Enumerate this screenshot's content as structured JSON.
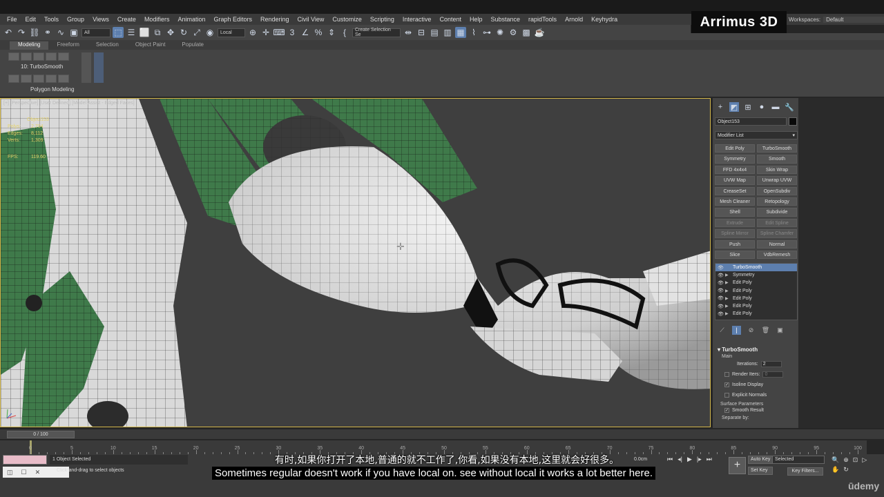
{
  "menu": [
    "File",
    "Edit",
    "Tools",
    "Group",
    "Views",
    "Create",
    "Modifiers",
    "Animation",
    "Graph Editors",
    "Rendering",
    "Civil View",
    "Customize",
    "Scripting",
    "Interactive",
    "Content",
    "Help",
    "Substance",
    "rapidTools",
    "Arnold",
    "Keyhydra"
  ],
  "brand": {
    "logo_text": "Arrimus 3D"
  },
  "workspace": {
    "label": "Workspaces:",
    "value": "Default"
  },
  "toolbar": {
    "filter_dropdown": "All",
    "coord_dropdown": "Local",
    "selection_set": "Create Selection Se"
  },
  "ribbon": {
    "tabs": [
      "Modeling",
      "Freeform",
      "Selection",
      "Object Paint",
      "Populate"
    ],
    "selected_tab": "Modeling",
    "modifier_label": "10: TurboSmooth",
    "panel_label": "Polygon Modeling"
  },
  "viewport": {
    "label": "[+] [Perspective] [User Defined] [Model Assist - Edged Faces]",
    "object": "Object153",
    "stats": [
      {
        "key": "Polys:",
        "value": "2,704"
      },
      {
        "key": "Edges:",
        "value": "8,112"
      },
      {
        "key": "Verts:",
        "value": "1,309"
      }
    ],
    "fps_label": "FPS:",
    "fps_value": "119.60"
  },
  "command_panel": {
    "object_name": "Object153",
    "modifier_list": "Modifier List",
    "buttons": [
      {
        "label": "Edit Poly",
        "enabled": true
      },
      {
        "label": "TurboSmooth",
        "enabled": true
      },
      {
        "label": "Symmetry",
        "enabled": true
      },
      {
        "label": "Smooth",
        "enabled": true
      },
      {
        "label": "FFD 4x4x4",
        "enabled": true
      },
      {
        "label": "Skin Wrap",
        "enabled": true
      },
      {
        "label": "UVW Map",
        "enabled": true
      },
      {
        "label": "Unwrap UVW",
        "enabled": true
      },
      {
        "label": "CreaseSet",
        "enabled": true
      },
      {
        "label": "OpenSubdiv",
        "enabled": true
      },
      {
        "label": "Mesh Cleaner",
        "enabled": true
      },
      {
        "label": "Retopology",
        "enabled": true
      },
      {
        "label": "Shell",
        "enabled": true
      },
      {
        "label": "Subdivide",
        "enabled": true
      },
      {
        "label": "Extrude",
        "enabled": false
      },
      {
        "label": "Edit Spline",
        "enabled": false
      },
      {
        "label": "Spline Mirror",
        "enabled": false
      },
      {
        "label": "Spline Chamfer",
        "enabled": false
      },
      {
        "label": "Push",
        "enabled": true
      },
      {
        "label": "Normal",
        "enabled": true
      },
      {
        "label": "Slice",
        "enabled": true
      },
      {
        "label": "VdbRemesh",
        "enabled": true
      }
    ],
    "stack": [
      {
        "label": "TurboSmooth",
        "selected": true,
        "expandable": false
      },
      {
        "label": "Symmetry",
        "selected": false,
        "expandable": true
      },
      {
        "label": "Edit Poly",
        "selected": false,
        "expandable": true
      },
      {
        "label": "Edit Poly",
        "selected": false,
        "expandable": true
      },
      {
        "label": "Edit Poly",
        "selected": false,
        "expandable": true
      },
      {
        "label": "Edit Poly",
        "selected": false,
        "expandable": true
      },
      {
        "label": "Edit Poly",
        "selected": false,
        "expandable": true
      }
    ],
    "turbosmooth": {
      "title": "TurboSmooth",
      "main": "Main",
      "iterations_label": "Iterations:",
      "iterations": "2",
      "render_iters_label": "Render Iters:",
      "render_iters": "0",
      "isoline_display": "Isoline Display",
      "explicit_normals": "Explicit Normals",
      "surface_params": "Surface Parameters",
      "smooth_result": "Smooth Result",
      "separate_by": "Separate by:"
    }
  },
  "timeline": {
    "slider": "0 / 100",
    "ticks": [
      "0",
      "5",
      "10",
      "15",
      "20",
      "25",
      "30",
      "35",
      "40",
      "45",
      "50",
      "55",
      "60",
      "65",
      "70",
      "75",
      "80",
      "85",
      "90",
      "95",
      "100"
    ]
  },
  "status": {
    "selected": "1 Object Selected",
    "prompt": "Click-and-drag to select objects",
    "coord": "0.0cm",
    "auto_key": "Auto Key",
    "set_key": "Set Key",
    "key_mode": "Selected",
    "key_filters": "Key Filters..."
  },
  "subtitles": {
    "chinese": "有时,如果你打开了本地,普通的就不工作了,你看,如果没有本地,这里就会好很多。",
    "english": "Sometimes regular doesn't work if you have local on. see without local it works a lot better here."
  },
  "watermark": "ūdemy"
}
